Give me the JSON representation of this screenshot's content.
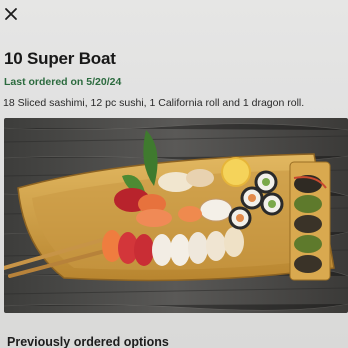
{
  "item": {
    "title": "10 Super Boat",
    "last_ordered": "Last ordered on 5/20/24",
    "description": "18 Sliced sashimi, 12 pc sushi, 1 California roll and 1 dragon roll."
  },
  "sections": {
    "previously_ordered": "Previously ordered options"
  },
  "icons": {
    "close": "close-icon"
  },
  "colors": {
    "accent_green": "#2c6b3f",
    "text_primary": "#181818"
  }
}
